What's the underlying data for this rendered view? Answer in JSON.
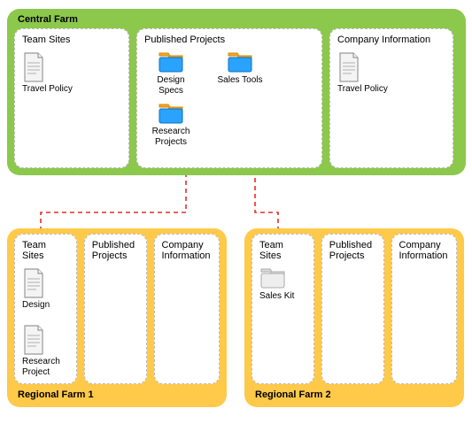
{
  "central": {
    "title": "Central Farm",
    "panels": {
      "team_sites": {
        "title": "Team Sites",
        "items": [
          {
            "label": "Travel Policy",
            "icon": "document"
          }
        ]
      },
      "published_projects": {
        "title": "Published Projects",
        "items": [
          {
            "label": "Design Specs",
            "icon": "folder-blue"
          },
          {
            "label": "Sales Tools",
            "icon": "folder-blue"
          },
          {
            "label": "Research Projects",
            "icon": "folder-blue"
          }
        ]
      },
      "company_info": {
        "title": "Company Information",
        "items": [
          {
            "label": "Travel Policy",
            "icon": "document"
          }
        ]
      }
    }
  },
  "regional1": {
    "title": "Regional Farm 1",
    "panels": {
      "team_sites": {
        "title": "Team Sites",
        "items": [
          {
            "label": "Design",
            "icon": "document"
          },
          {
            "label": "Research Project",
            "icon": "document"
          }
        ]
      },
      "published_projects": {
        "title": "Published Projects",
        "items": []
      },
      "company_info": {
        "title": "Company Information",
        "items": []
      }
    }
  },
  "regional2": {
    "title": "Regional Farm 2",
    "panels": {
      "team_sites": {
        "title": "Team Sites",
        "items": [
          {
            "label": "Sales Kit",
            "icon": "folder-grey"
          }
        ]
      },
      "published_projects": {
        "title": "Published Projects",
        "items": []
      },
      "company_info": {
        "title": "Company Information",
        "items": []
      }
    }
  },
  "connections": [
    {
      "from": "central.team_sites.Travel Policy",
      "to": "central.company_info.Travel Policy",
      "style": "solid"
    },
    {
      "from": "regional1.team_sites",
      "to": "central.published_projects.Design Specs",
      "style": "dashed"
    },
    {
      "from": "regional2.team_sites",
      "to": "central.published_projects.Sales Tools",
      "style": "dashed"
    }
  ]
}
